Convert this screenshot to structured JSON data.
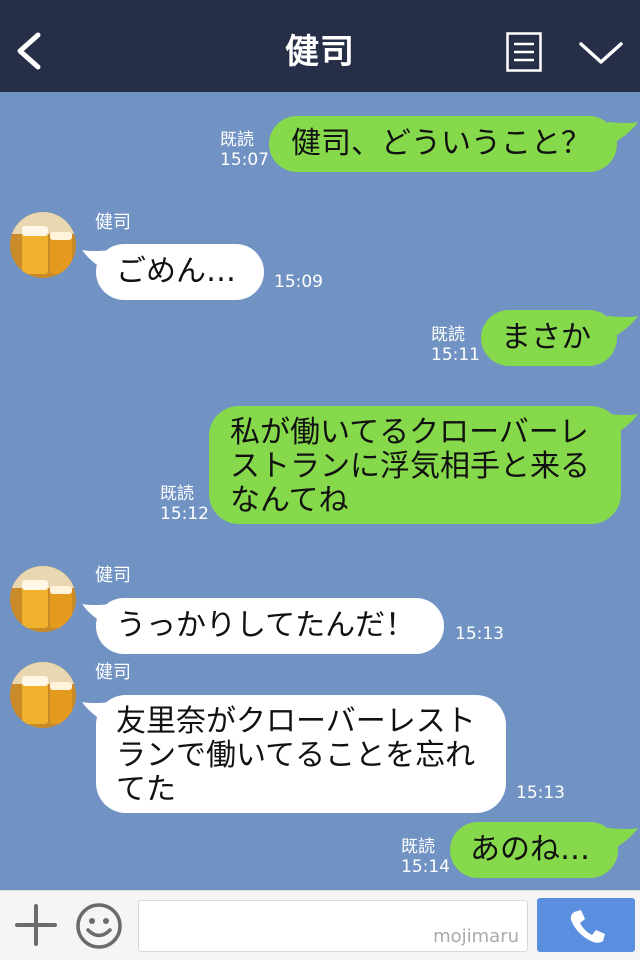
{
  "header": {
    "title": "健司"
  },
  "messages": [
    {
      "dir": "out",
      "text": "健司、どういうこと？",
      "read": "既読",
      "time": "15:07"
    },
    {
      "dir": "in",
      "name": "健司",
      "text": "ごめん…",
      "time": "15:09"
    },
    {
      "dir": "out",
      "text": "まさか",
      "read": "既読",
      "time": "15:11"
    },
    {
      "dir": "out",
      "lines": [
        "私が働いてるクローバーレ",
        "ストランに浮気相手と来る",
        "なんてね"
      ],
      "read": "既読",
      "time": "15:12"
    },
    {
      "dir": "in",
      "name": "健司",
      "text": "うっかりしてたんだ！",
      "time": "15:13"
    },
    {
      "dir": "in",
      "name": "健司",
      "lines": [
        "友里奈がクローバーレスト",
        "ランで働いてることを忘れ",
        "てた"
      ],
      "time": "15:13"
    },
    {
      "dir": "out",
      "text": "あのね…",
      "read": "既読",
      "time": "15:14"
    }
  ],
  "footer": {
    "watermark": "mojimaru"
  },
  "colors": {
    "header": "#262f47",
    "background": "#7193c3",
    "outgoing_bubble": "#86d94b",
    "incoming_bubble": "#ffffff",
    "call_button": "#5a8fe0"
  },
  "icons": {
    "back": "chevron-left-icon",
    "menu": "document-icon",
    "collapse": "chevron-down-icon",
    "add": "plus-icon",
    "emoji": "smiley-icon",
    "call": "phone-icon"
  }
}
